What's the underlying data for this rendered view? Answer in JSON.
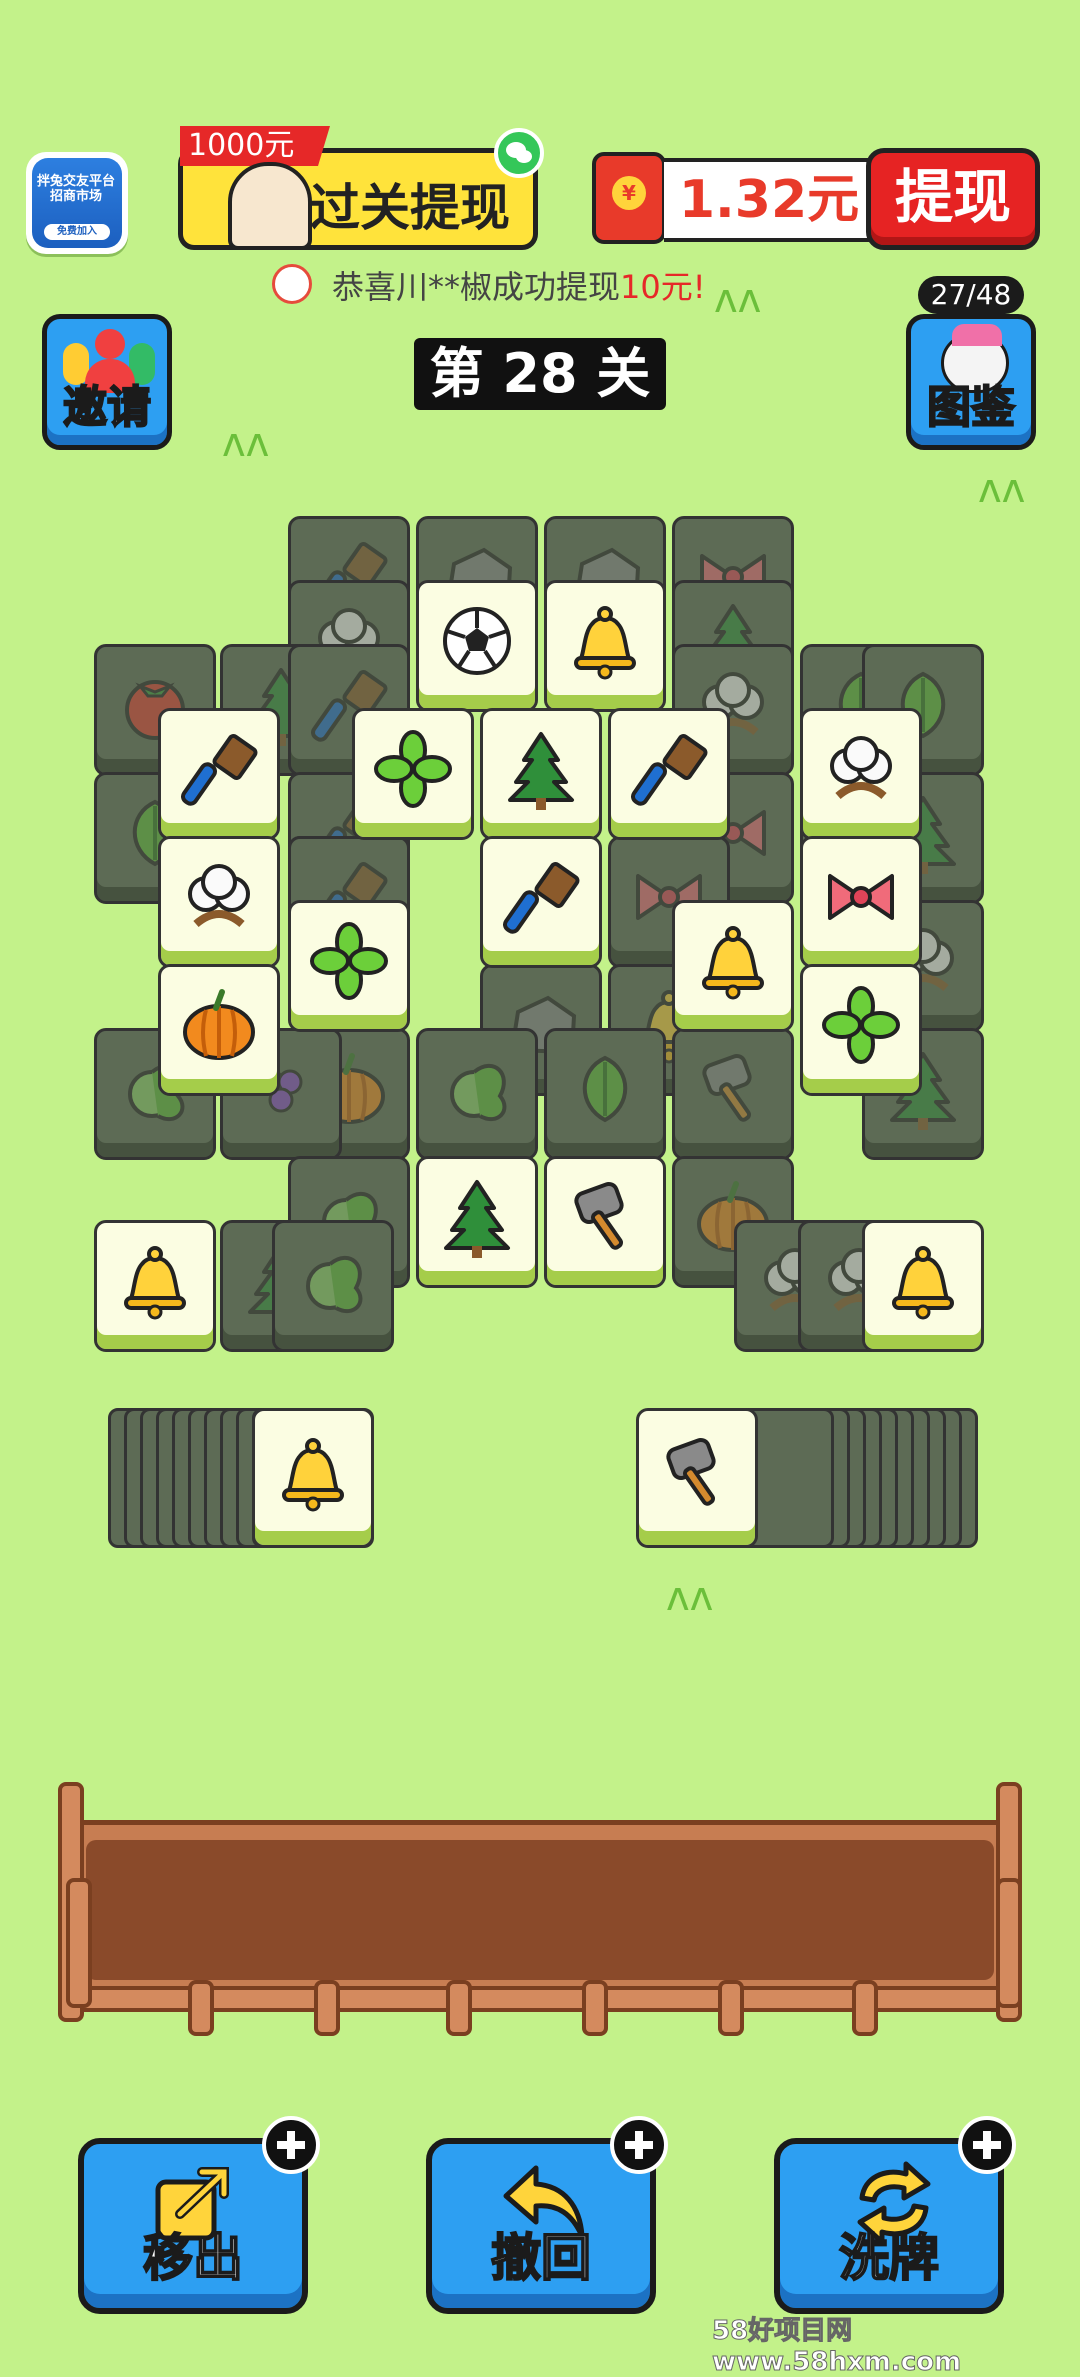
{
  "header": {
    "app_icon_text": "拌兔交友平台 招商市场",
    "app_icon_button": "免费加入",
    "banner_tag": "1000元",
    "banner_text": "过关提现",
    "balance": "1.32元",
    "withdraw_label": "提现",
    "notice_prefix": "恭喜川**椒成功提现",
    "notice_amount": "10元!"
  },
  "side": {
    "invite_label": "邀请",
    "atlas_label": "图鉴",
    "atlas_progress": "27/48"
  },
  "level_title": "第 28 关",
  "bottom": {
    "move_out_label": "移出",
    "undo_label": "撤回",
    "shuffle_label": "洗牌"
  },
  "watermark": "58好项目网www.58hxm.com",
  "colors": {
    "background": "#c3f28a",
    "button_blue": "#2d9ff2",
    "withdraw_red": "#e62323",
    "tile_dark": "#5d6b55",
    "tile_light": "#fbfde2"
  },
  "icons": {
    "brush": "brush-icon",
    "rock": "rock-icon",
    "bow": "bow-icon",
    "cotton": "cotton-icon",
    "ball": "soccer-ball-icon",
    "bell": "bell-icon",
    "tree": "pine-tree-icon",
    "tomato": "tomato-icon",
    "leaf": "leaf-icon",
    "clover": "clover-icon",
    "pumpkin": "pumpkin-icon",
    "cabbage": "cabbage-icon",
    "hammer": "hammer-icon",
    "grape": "grape-icon"
  },
  "board": {
    "tiles": [
      {
        "icon": "brush",
        "state": "covered"
      },
      {
        "icon": "rock",
        "state": "covered"
      },
      {
        "icon": "rock",
        "state": "covered"
      },
      {
        "icon": "bow",
        "state": "covered"
      },
      {
        "icon": "cotton",
        "state": "covered"
      },
      {
        "icon": "ball",
        "state": "open"
      },
      {
        "icon": "bell",
        "state": "open"
      },
      {
        "icon": "tree",
        "state": "covered"
      },
      {
        "icon": "tomato",
        "state": "covered"
      },
      {
        "icon": "tree",
        "state": "covered"
      },
      {
        "icon": "brush",
        "state": "covered"
      },
      {
        "icon": "cotton",
        "state": "covered"
      },
      {
        "icon": "leaf",
        "state": "covered"
      },
      {
        "icon": "leaf",
        "state": "covered"
      },
      {
        "icon": "leaf",
        "state": "covered"
      },
      {
        "icon": "brush",
        "state": "covered"
      },
      {
        "icon": "brush",
        "state": "covered"
      },
      {
        "icon": "bow",
        "state": "covered"
      },
      {
        "icon": "tree",
        "state": "covered"
      },
      {
        "icon": "tree",
        "state": "covered"
      },
      {
        "icon": "brush",
        "state": "covered"
      },
      {
        "icon": "bow",
        "state": "covered"
      },
      {
        "icon": "cotton",
        "state": "covered"
      },
      {
        "icon": "rock",
        "state": "covered"
      },
      {
        "icon": "bell",
        "state": "covered"
      },
      {
        "icon": "cabbage",
        "state": "covered"
      },
      {
        "icon": "pumpkin",
        "state": "covered"
      },
      {
        "icon": "cabbage",
        "state": "covered"
      },
      {
        "icon": "leaf",
        "state": "covered"
      },
      {
        "icon": "hammer",
        "state": "covered"
      },
      {
        "icon": "tree",
        "state": "covered"
      },
      {
        "icon": "grape",
        "state": "covered"
      },
      {
        "icon": "cabbage",
        "state": "covered"
      },
      {
        "icon": "pumpkin",
        "state": "covered"
      },
      {
        "icon": "brush",
        "state": "open"
      },
      {
        "icon": "clover",
        "state": "open"
      },
      {
        "icon": "tree",
        "state": "open"
      },
      {
        "icon": "brush",
        "state": "open"
      },
      {
        "icon": "cotton",
        "state": "open"
      },
      {
        "icon": "cotton",
        "state": "open"
      },
      {
        "icon": "brush",
        "state": "open"
      },
      {
        "icon": "bow",
        "state": "open"
      },
      {
        "icon": "clover",
        "state": "open"
      },
      {
        "icon": "bell",
        "state": "open"
      },
      {
        "icon": "pumpkin",
        "state": "open"
      },
      {
        "icon": "clover",
        "state": "open"
      },
      {
        "icon": "tree",
        "state": "open"
      },
      {
        "icon": "hammer",
        "state": "open"
      },
      {
        "icon": "tree",
        "state": "covered"
      },
      {
        "icon": "cabbage",
        "state": "covered"
      },
      {
        "icon": "bell",
        "state": "open"
      },
      {
        "icon": "cotton",
        "state": "covered"
      },
      {
        "icon": "cotton",
        "state": "covered"
      },
      {
        "icon": "bell",
        "state": "open"
      }
    ],
    "left_pile_top": "bell",
    "right_pile_top": "hammer"
  }
}
